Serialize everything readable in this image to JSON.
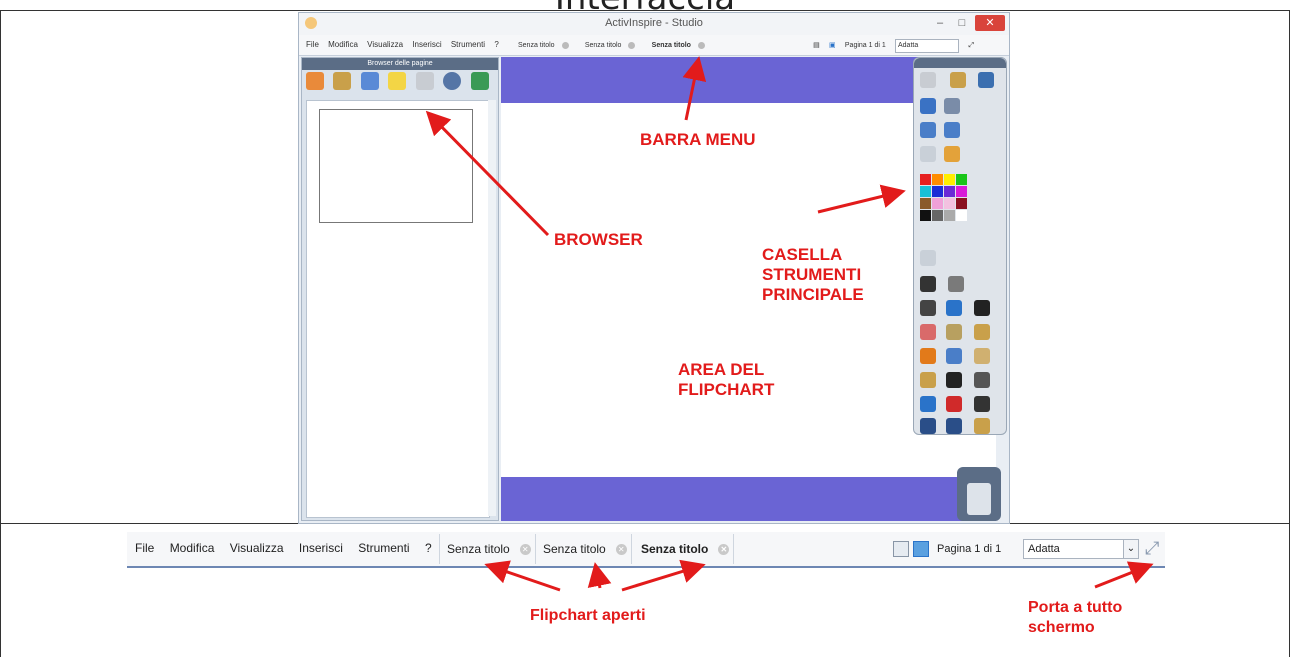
{
  "slide_title": "Interfaccia",
  "window": {
    "title": "ActivInspire - Studio",
    "menu": [
      "File",
      "Modifica",
      "Visualizza",
      "Inserisci",
      "Strumenti",
      "?"
    ],
    "tabs": [
      "Senza titolo",
      "Senza titolo",
      "Senza titolo"
    ],
    "page_label": "Pagina 1 di 1",
    "zoom_value": "Adatta",
    "browser_title": "Browser delle pagine"
  },
  "annotations": {
    "menu_bar": "BARRA MENU",
    "browser": "BROWSER",
    "toolbox_line1": "CASELLA",
    "toolbox_line2": "STRUMENTI",
    "toolbox_line3": "PRINCIPALE",
    "flipchart_line1": "AREA DEL",
    "flipchart_line2": "FLIPCHART",
    "open_flipcharts": "Flipchart aperti",
    "fullscreen_line1": "Porta a tutto",
    "fullscreen_line2": "schermo"
  },
  "strip": {
    "menu": [
      "File",
      "Modifica",
      "Visualizza",
      "Inserisci",
      "Strumenti",
      "?"
    ],
    "tabs": [
      {
        "label": "Senza titolo",
        "active": false
      },
      {
        "label": "Senza titolo",
        "active": false
      },
      {
        "label": "Senza titolo",
        "active": true
      }
    ],
    "page_label": "Pagina 1 di 1",
    "zoom_value": "Adatta",
    "icons": [
      "page-view-icon",
      "desktop-icon",
      "dropdown-arrow-icon",
      "fullscreen-icon"
    ]
  },
  "colors": {
    "band": "#6a64d4",
    "annotation": "#e21b1b",
    "palette": [
      "#e62020",
      "#ff8c00",
      "#ffee00",
      "#19c519",
      "#18c0d8",
      "#1a2dd6",
      "#6a2ad6",
      "#d81ad8",
      "#8a5a2a",
      "#f0a0d8",
      "#f3c1e0",
      "#8a1020",
      "#111111",
      "#666666",
      "#aaaaaa",
      "#ffffff"
    ]
  }
}
